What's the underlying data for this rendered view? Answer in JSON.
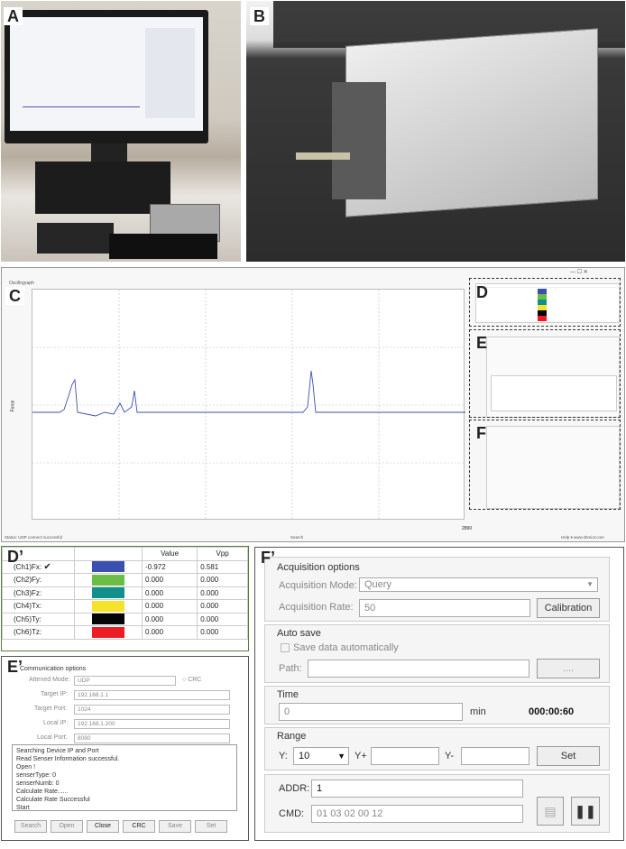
{
  "panels": {
    "a": "A",
    "b": "B",
    "c": "C",
    "d": "D",
    "e": "E",
    "f": "F",
    "dp": "D’",
    "ep": "E’",
    "fp": "F’"
  },
  "screen": {
    "title": "Oscillograph",
    "status": "Status: UDP connect successful",
    "search": "Search",
    "help": "Help ▾  www.sbmiot.com",
    "ylabel": "Force",
    "y_ticks": [
      "10",
      "5",
      "0",
      "-5",
      "-10"
    ],
    "x_end": "2890"
  },
  "channels": {
    "header_value": "Value",
    "header_vpp": "Vpp",
    "rows": [
      {
        "name": "(Ch1)Fx:",
        "check": "✔",
        "color": "#3a4fae",
        "value": "-0.972",
        "vpp": "0.581"
      },
      {
        "name": "(Ch2)Fy:",
        "check": "",
        "color": "#6cbd45",
        "value": "0.000",
        "vpp": "0.000"
      },
      {
        "name": "(Ch3)Fz:",
        "check": "",
        "color": "#12918c",
        "value": "0.000",
        "vpp": "0.000"
      },
      {
        "name": "(Ch4)Tx:",
        "check": "",
        "color": "#f5e22a",
        "value": "0.000",
        "vpp": "0.000"
      },
      {
        "name": "(Ch5)Ty:",
        "check": "",
        "color": "#050505",
        "value": "0.000",
        "vpp": "0.000"
      },
      {
        "name": "(Ch6)Tz:",
        "check": "",
        "color": "#ed1c24",
        "value": "0.000",
        "vpp": "0.000"
      }
    ]
  },
  "comm": {
    "title": "Communication options",
    "mode_label": "Attened Mode:",
    "mode_value": "UDP",
    "crc": "CRC",
    "tip_label": "Target IP:",
    "tip_value": "192.168.1.1",
    "tport_label": "Target Port:",
    "tport_value": "1024",
    "lip_label": "Local IP:",
    "lip_value": "192.168.1.200",
    "lport_label": "Local Port:",
    "lport_value": "8080",
    "log": [
      "Searching Device IP and Port",
      "Read Senser Information successful.",
      "Open !",
      "senserType: 0",
      "senserNumb: 0",
      "Calculate Rate......",
      "Calculate Rate Successful",
      "Start"
    ],
    "buttons": [
      "Search",
      "Open",
      "Close",
      "CRC",
      "Save",
      "Set"
    ]
  },
  "acq": {
    "title": "Acquisition options",
    "mode_label": "Acquisition Mode:",
    "mode_value": "Query",
    "rate_label": "Acquisition Rate:",
    "rate_value": "50",
    "calibration": "Calibration",
    "autosave_title": "Auto save",
    "autosave_check": "Save data automatically",
    "path_label": "Path:",
    "browse": "....",
    "time_title": "Time",
    "time_value": "0",
    "time_unit": "min",
    "time_clock": "000:00:60",
    "range_title": "Range",
    "y_label": "Y:",
    "y_value": "10",
    "yplus": "Y+",
    "yminus": "Y-",
    "set": "Set",
    "addr_label": "ADDR:",
    "addr_value": "1",
    "cmd_label": "CMD:",
    "cmd_value": "01 03 02 00 12",
    "pause": "❚❚"
  }
}
